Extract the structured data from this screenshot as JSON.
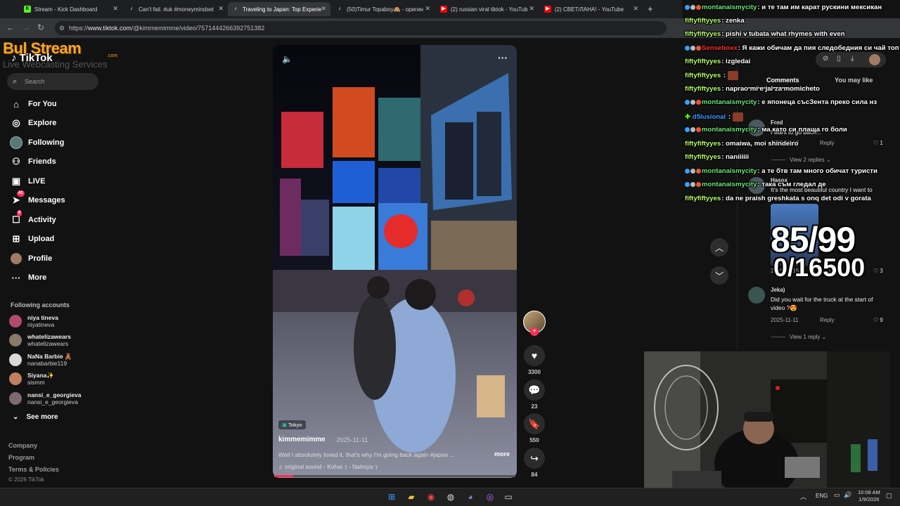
{
  "browser": {
    "tabs": [
      {
        "title": "Stream - Kick Dashboard",
        "icon": "kick-icon",
        "color": "#53fc18"
      },
      {
        "title": "Can't fail. #uk #moneymindset",
        "icon": "tiktok-icon",
        "color": "#ffffff"
      },
      {
        "title": "Traveling to Japan: Top Experie",
        "icon": "tiktok-icon",
        "color": "#ffffff"
      },
      {
        "title": "(50)Timur Topaboy🙈 - оригин",
        "icon": "tiktok-icon",
        "color": "#ffffff"
      },
      {
        "title": "(2) russian viral tiktok - YouTub",
        "icon": "youtube-icon",
        "color": "#ff0000"
      },
      {
        "title": "(2) СВЕТ/ЛАНА! - YouTube",
        "icon": "youtube-icon",
        "color": "#ff0000"
      }
    ],
    "new_tab_glyph": "+",
    "url_prefix": "https://",
    "url_host": "www.tiktok.com",
    "url_path": "/@kimmemimme/video/7571444266392751382"
  },
  "overlay_logo": {
    "brand": "Bul Stream",
    "suffix": ".com",
    "tagline": "Live Webcasting Services",
    "tiktok": "TikTok"
  },
  "sidebar": {
    "search_placeholder": "Search",
    "nav": [
      {
        "label": "For You",
        "icon": "home-icon"
      },
      {
        "label": "Explore",
        "icon": "compass-icon"
      },
      {
        "label": "Following",
        "icon": "following-avatar-icon"
      },
      {
        "label": "Friends",
        "icon": "friends-icon"
      },
      {
        "label": "LIVE",
        "icon": "live-icon"
      },
      {
        "label": "Messages",
        "icon": "send-icon",
        "badge": "42"
      },
      {
        "label": "Activity",
        "icon": "inbox-icon",
        "badge": "6"
      },
      {
        "label": "Upload",
        "icon": "upload-icon"
      },
      {
        "label": "Profile",
        "icon": "profile-avatar-icon"
      },
      {
        "label": "More",
        "icon": "more-dots-icon"
      }
    ],
    "following_title": "Following accounts",
    "accounts": [
      {
        "name": "niya tineva",
        "handle": "niyatineva"
      },
      {
        "name": "whatelizawears",
        "handle": "whatelizawears"
      },
      {
        "name": "NaNa Barbie 🧸",
        "handle": "nanabarbie119"
      },
      {
        "name": "Siyana✨",
        "handle": "sismm"
      },
      {
        "name": "nansi_e_georgieva",
        "handle": "nansi_e_georgieva"
      }
    ],
    "see_more": "See more",
    "footer": [
      "Company",
      "Program",
      "Terms & Policies"
    ],
    "copyright": "© 2026 TikTok"
  },
  "video": {
    "location_tag": "Tokyo",
    "author": "kimmemimme",
    "date": "· 2025-11-11",
    "description": "Well I absolutely loved it, that's why I'm going back again #japan ...",
    "more": "more",
    "sound": "♫  original sound - Kohai ⁊ - Nahoya ⁊",
    "progress": 0.08
  },
  "actions": {
    "likes": "3300",
    "comments": "23",
    "saves": "550",
    "shares": "84"
  },
  "comments_panel": {
    "tab_comments": "Comments",
    "tab_you_may_like": "You may like",
    "comments": [
      {
        "user": "Fred",
        "text": "I want to go back...",
        "date": "2025-11-12",
        "reply": "Reply",
        "likes": "1",
        "view_replies": "View 2 replies"
      },
      {
        "user": "Hasox",
        "text": "It's the most beautiful country I want to",
        "date": "2025-11-15",
        "reply": "Reply",
        "likes": "3"
      },
      {
        "user": "Jeka)",
        "text": "Did you wait for the truck at the start of video ?😍",
        "date": "2025-11-11",
        "reply": "Reply",
        "likes": "9",
        "view_replies": "View 1 reply"
      }
    ]
  },
  "chat": [
    {
      "user": "montanaismycity",
      "color": "#6ee77a",
      "badges": true,
      "text": ": и те там им карат рускини мексикан"
    },
    {
      "user": "fiftyfiftyyes",
      "color": "#b8ff6b",
      "text": ": zenka"
    },
    {
      "user": "fiftyfiftyyes",
      "color": "#b8ff6b",
      "text": ": pishi v tubata what rhymes with even"
    },
    {
      "user": "Senseboxx",
      "color": "#ff3030",
      "badges": true,
      "text": ": Я кажи обичам да пия следобедния си чай топ"
    },
    {
      "user": "fiftyfiftyyes",
      "color": "#b8ff6b",
      "text": ": izgledai"
    },
    {
      "user": "fiftyfiftyyes",
      "color": "#b8ff6b",
      "emote": true,
      "text": ""
    },
    {
      "user": "fiftyfiftyyes",
      "color": "#b8ff6b",
      "text": ": naprao mi e jal za momicheto"
    },
    {
      "user": "montanaismycity",
      "color": "#6ee77a",
      "badges": true,
      "text": ": е японеца съсЗента преко сила нз"
    },
    {
      "user": "d5lusional",
      "color": "#3aa0ff",
      "plus": true,
      "emote": true,
      "text": ""
    },
    {
      "user": "montanaismycity",
      "color": "#6ee77a",
      "badges": true,
      "text": ": ма като си плаща го боли"
    },
    {
      "user": "fiftyfiftyyes",
      "color": "#b8ff6b",
      "text": ": omaiwa, moi shindeiro"
    },
    {
      "user": "fiftyfiftyyes",
      "color": "#b8ff6b",
      "text": ": naniiiiii"
    },
    {
      "user": "montanaismycity",
      "color": "#6ee77a",
      "badges": true,
      "text": ": а те бтв там много обичат туристи"
    },
    {
      "user": "montanaismycity",
      "color": "#6ee77a",
      "badges": true,
      "text": ": така съм гледал де"
    },
    {
      "user": "fiftyfiftyyes",
      "color": "#b8ff6b",
      "text": ": da ne praish greshkata s onq det odi v gorata"
    }
  ],
  "counter": {
    "line1": "85/99",
    "line2": "0/16500"
  },
  "taskbar": {
    "lang": "ENG",
    "time": "10:08 AM",
    "date": "1/9/2026"
  },
  "colors": {
    "accent": "#fe2c55",
    "bg": "#121212"
  }
}
